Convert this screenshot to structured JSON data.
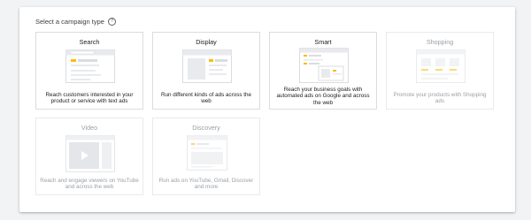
{
  "heading": {
    "label": "Select a campaign type",
    "help_icon": "?"
  },
  "cards": [
    {
      "name": "search",
      "title": "Search",
      "description": "Reach customers interested in your product or service with text ads",
      "enabled": true
    },
    {
      "name": "display",
      "title": "Display",
      "description": "Run different kinds of ads across the web",
      "enabled": true
    },
    {
      "name": "smart",
      "title": "Smart",
      "description": "Reach your business goals with automated ads on Google and across the web",
      "enabled": true
    },
    {
      "name": "shopping",
      "title": "Shopping",
      "description": "Promote your products with Shopping ads",
      "enabled": false
    },
    {
      "name": "video",
      "title": "Video",
      "description": "Reach and engage viewers on YouTube and across the web",
      "enabled": false
    },
    {
      "name": "discovery",
      "title": "Discovery",
      "description": "Run ads on YouTube, Gmail, Discover and more",
      "enabled": false
    }
  ],
  "colors": {
    "accent_yellow": "#fbbc04",
    "border": "#dadce0",
    "disabled_text": "#9aa0a6"
  }
}
